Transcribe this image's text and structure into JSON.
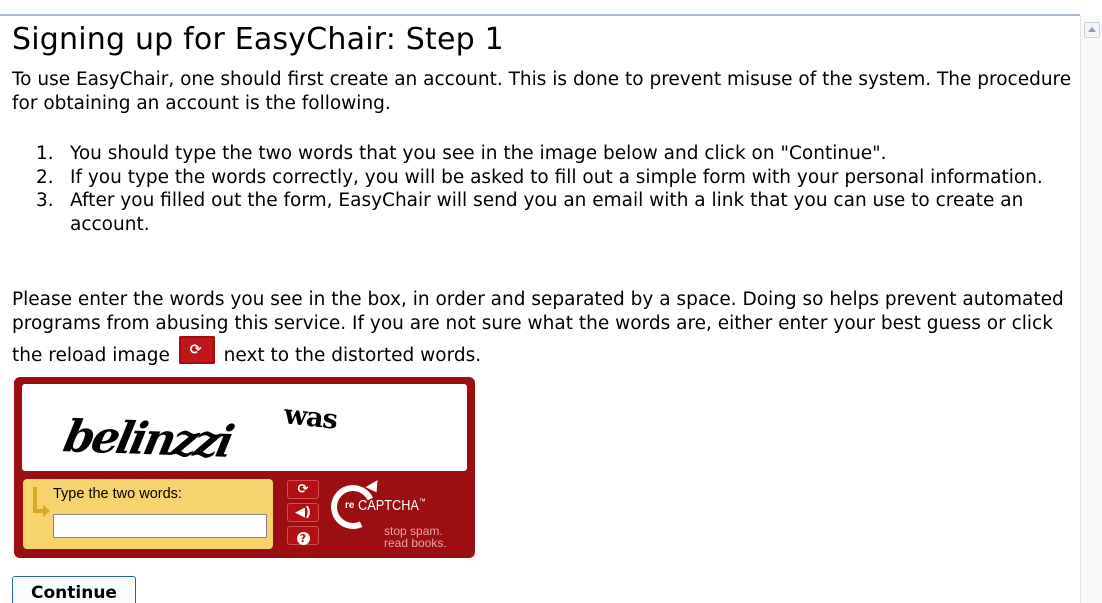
{
  "page": {
    "title": "Signing up for EasyChair: Step 1",
    "intro": "To use EasyChair, one should first create an account. This is done to prevent misuse of the system. The procedure for obtaining an account is the following.",
    "steps": [
      {
        "num": "1.",
        "text": "You should type the two words that you see in the image below and click on \"Continue\"."
      },
      {
        "num": "2.",
        "text": "If you type the words correctly, you will be asked to fill out a simple form with your personal information."
      },
      {
        "num": "3.",
        "text": "After you filled out the form, EasyChair will send you an email with a link that you can use to create an account."
      }
    ],
    "instructions_before": "Please enter the words you see in the box, in order and separated by a space. Doing so helps prevent automated programs from abusing this service. If you are not sure what the words are, either enter your best guess or click the reload image",
    "instructions_after": "next to the distorted words.",
    "continue_label": "Continue"
  },
  "captcha": {
    "word1": "belinzzi",
    "word2": "was",
    "prompt_label": "Type the two words:",
    "response_value": "",
    "buttons": {
      "reload": "reload-icon",
      "audio": "speaker-icon",
      "help": "help-icon"
    },
    "logo": {
      "prefix": "re",
      "name": "CAPTCHA",
      "tm": "™",
      "tagline1": "stop spam.",
      "tagline2": "read books."
    },
    "colors": {
      "frame": "#9b0f12",
      "input_panel": "#f7d36e"
    }
  }
}
